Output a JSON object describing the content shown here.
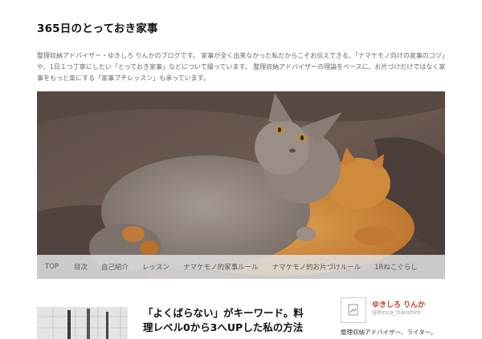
{
  "site": {
    "title": "365日のとっておき家事",
    "description": "整理収納アドバイザー・ゆきしろ りんかのブログです。 家事が全く出来なかった私だからこそお伝えできる、「ナマケモノ向けの家事のコツ」や、1日１つ丁寧にしたい「とっておき家事」などについて綴っています。 整理収納アドバイザーの理論をベースに、お片づけだけではなく家事をもっと楽にする「家事プチレッスン」も承っています。"
  },
  "nav": {
    "items": [
      {
        "label": "TOP"
      },
      {
        "label": "目次"
      },
      {
        "label": "自己紹介"
      },
      {
        "label": "レッスン"
      },
      {
        "label": "ナマケモノ的家事ルール"
      },
      {
        "label": "ナマケモノ的お片づけルール"
      },
      {
        "label": "1Rねこぐらし"
      }
    ]
  },
  "post": {
    "title": "「よくばらない」がキーワード。料理レベル0から3へUPした私の方法"
  },
  "profile": {
    "name": "ゆきしろ りんか",
    "handle": "@Rinca_Yukishiro",
    "bio": "整理収納アドバイザー、ライター。"
  },
  "colors": {
    "accent": "#c0392b",
    "nav_bg": "#e1e1e1"
  }
}
